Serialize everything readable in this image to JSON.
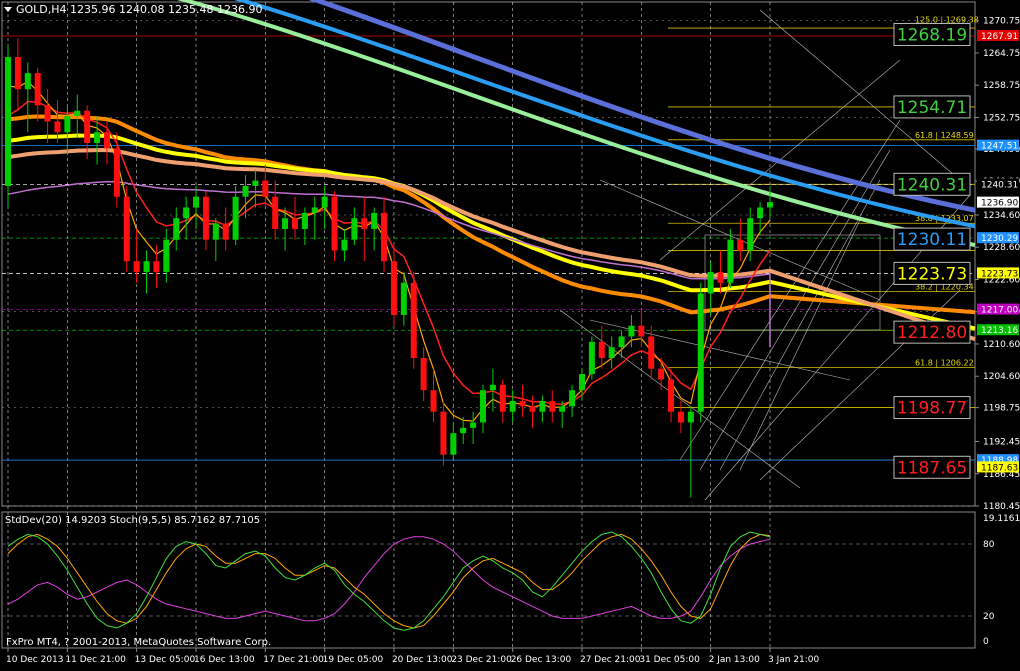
{
  "window": {
    "symbol_line": "GOLD,H4  1235.96 1240.08 1235.48 1236.90",
    "indicator_line": "StdDev(20) 14.9203  Stoch(9,5,5) 85.7162 87.7105",
    "copyright": "FxPro MT4, ? 2001-2013, MetaQuotes Software Corp."
  },
  "colors": {
    "background": "#000000",
    "grid": "#cfcfcf",
    "bull_candle": "#00d000",
    "bear_candle": "#ff1010",
    "ema_fast": "#ffa500",
    "ema_red": "#ff2020",
    "ema_orange": "#ff8c00",
    "ema_yellow": "#ffff00",
    "ema_salmon": "#f0a070",
    "ema_violet": "#c070d0",
    "ema_lightgreen": "#99ee99",
    "ema_blue": "#2a9df4",
    "ema_slateblue": "#5a6fd8"
  },
  "chart_data": {
    "type": "candlestick",
    "symbol": "GOLD",
    "timeframe": "H4",
    "ylim": [
      1180.45,
      1272.0
    ],
    "y_ticks": [
      "1270.75",
      "1264.75",
      "1258.75",
      "1252.75",
      "1246.90",
      "1240.90",
      "1234.60",
      "1228.60",
      "1222.60",
      "1216.60",
      "1210.60",
      "1204.60",
      "1198.75",
      "1192.45",
      "1186.45",
      "1180.45"
    ],
    "x_ticks": [
      "10 Dec 2013",
      "11 Dec 21:00",
      "13 Dec 05:00",
      "16 Dec 13:00",
      "17 Dec 21:00",
      "19 Dec 05:00",
      "20 Dec 13:00",
      "23 Dec 21:00",
      "26 Dec 13:00",
      "27 Dec 21:00",
      "31 Dec 05:00",
      "2 Jan 13:00",
      "3 Jan 21:00"
    ],
    "price_tags": [
      {
        "text": "1267.91",
        "bg": "#e00000",
        "fg": "#ffffff"
      },
      {
        "text": "1247.51",
        "bg": "#1e90ff",
        "fg": "#ffffff"
      },
      {
        "text": "1240.31",
        "bg": "#000000",
        "fg": "#ffffff"
      },
      {
        "text": "1236.90",
        "bg": "#ffffff",
        "fg": "#000000"
      },
      {
        "text": "1230.29",
        "bg": "#1e90ff",
        "fg": "#ffffff"
      },
      {
        "text": "1223.73",
        "bg": "#ffff00",
        "fg": "#000000"
      },
      {
        "text": "1217.00",
        "bg": "#c000c0",
        "fg": "#ffffff"
      },
      {
        "text": "1213.16",
        "bg": "#00c000",
        "fg": "#ffffff"
      },
      {
        "text": "1188.98",
        "bg": "#1e90ff",
        "fg": "#ffffff"
      },
      {
        "text": "1187.63",
        "bg": "#ffff00",
        "fg": "#000000"
      }
    ],
    "levels": [
      {
        "text": "1268.19",
        "value": 1268.19,
        "color": "#40d040"
      },
      {
        "text": "1254.71",
        "value": 1254.71,
        "color": "#40d040"
      },
      {
        "text": "1240.31",
        "value": 1240.31,
        "color": "#40d040"
      },
      {
        "text": "1230.11",
        "value": 1230.11,
        "color": "#2a9df4"
      },
      {
        "text": "1223.73",
        "value": 1223.73,
        "color": "#ffff00"
      },
      {
        "text": "1212.80",
        "value": 1212.8,
        "color": "#ff2020"
      },
      {
        "text": "1198.77",
        "value": 1198.77,
        "color": "#ff2020"
      },
      {
        "text": "1187.65",
        "value": 1187.65,
        "color": "#ff2020"
      }
    ],
    "fib_labels": [
      {
        "text": "125.0 | 1269.38",
        "value": 1270.0
      },
      {
        "text": "61.8 | 1248.59",
        "value": 1248.59
      },
      {
        "text": "38.8 | 1233.07",
        "value": 1233.07
      },
      {
        "text": "38.2 | 1220.34",
        "value": 1220.34
      },
      {
        "text": "61.8 | 1206.22",
        "value": 1206.22
      }
    ],
    "fib_levels": [
      1269.38,
      1254.71,
      1248.59,
      1240.31,
      1233.07,
      1228.0,
      1220.34,
      1213.16,
      1206.22,
      1198.77,
      1188.98
    ],
    "candles": [
      [
        1240.0,
        1266.0,
        1236.0,
        1264.0
      ],
      [
        1264.0,
        1267.5,
        1254.0,
        1258.0
      ],
      [
        1258.0,
        1263.0,
        1250.0,
        1261.0
      ],
      [
        1261.0,
        1262.0,
        1252.0,
        1255.0
      ],
      [
        1255.0,
        1258.0,
        1248.0,
        1252.0
      ],
      [
        1252.0,
        1256.0,
        1248.0,
        1250.0
      ],
      [
        1250.0,
        1255.0,
        1246.0,
        1253.0
      ],
      [
        1253.0,
        1257.0,
        1249.0,
        1254.0
      ],
      [
        1254.0,
        1255.0,
        1245.0,
        1248.0
      ],
      [
        1248.0,
        1253.0,
        1244.0,
        1250.0
      ],
      [
        1250.0,
        1252.0,
        1244.0,
        1247.0
      ],
      [
        1247.0,
        1250.0,
        1236.0,
        1238.0
      ],
      [
        1238.0,
        1240.0,
        1224.0,
        1226.0
      ],
      [
        1226.0,
        1232.0,
        1222.0,
        1224.0
      ],
      [
        1224.0,
        1228.0,
        1220.0,
        1226.0
      ],
      [
        1226.0,
        1229.0,
        1221.0,
        1224.0
      ],
      [
        1224.0,
        1232.0,
        1222.0,
        1230.0
      ],
      [
        1230.0,
        1236.0,
        1228.0,
        1234.0
      ],
      [
        1234.0,
        1238.0,
        1230.0,
        1236.0
      ],
      [
        1236.0,
        1240.0,
        1232.0,
        1238.0
      ],
      [
        1238.0,
        1239.0,
        1228.0,
        1230.0
      ],
      [
        1230.0,
        1234.0,
        1226.0,
        1233.0
      ],
      [
        1233.0,
        1236.0,
        1228.0,
        1230.0
      ],
      [
        1230.0,
        1240.0,
        1229.0,
        1238.0
      ],
      [
        1238.0,
        1242.0,
        1234.0,
        1240.0
      ],
      [
        1240.0,
        1243.0,
        1236.0,
        1241.0
      ],
      [
        1241.0,
        1244.0,
        1236.0,
        1238.0
      ],
      [
        1238.0,
        1241.0,
        1230.0,
        1232.0
      ],
      [
        1232.0,
        1236.0,
        1228.0,
        1234.0
      ],
      [
        1234.0,
        1238.0,
        1230.0,
        1232.0
      ],
      [
        1232.0,
        1236.0,
        1229.0,
        1235.0
      ],
      [
        1235.0,
        1238.0,
        1230.0,
        1236.0
      ],
      [
        1236.0,
        1240.0,
        1232.0,
        1238.0
      ],
      [
        1238.0,
        1239.0,
        1226.0,
        1228.0
      ],
      [
        1228.0,
        1232.0,
        1226.0,
        1230.0
      ],
      [
        1230.0,
        1236.0,
        1229.0,
        1234.0
      ],
      [
        1234.0,
        1238.0,
        1226.0,
        1232.0
      ],
      [
        1232.0,
        1236.0,
        1228.0,
        1235.0
      ],
      [
        1235.0,
        1238.0,
        1224.0,
        1226.0
      ],
      [
        1226.0,
        1229.0,
        1214.0,
        1216.0
      ],
      [
        1216.0,
        1224.0,
        1214.0,
        1222.0
      ],
      [
        1222.0,
        1224.0,
        1206.0,
        1208.0
      ],
      [
        1208.0,
        1210.0,
        1200.0,
        1202.0
      ],
      [
        1202.0,
        1206.0,
        1196.0,
        1198.0
      ],
      [
        1198.0,
        1200.0,
        1188.0,
        1190.0
      ],
      [
        1190.0,
        1196.0,
        1189.0,
        1194.0
      ],
      [
        1194.0,
        1197.0,
        1192.0,
        1195.0
      ],
      [
        1195.0,
        1198.0,
        1192.0,
        1196.0
      ],
      [
        1196.0,
        1203.0,
        1194.0,
        1202.0
      ],
      [
        1202.0,
        1206.0,
        1198.0,
        1203.0
      ],
      [
        1203.0,
        1204.0,
        1196.0,
        1198.0
      ],
      [
        1198.0,
        1202.0,
        1196.0,
        1200.0
      ],
      [
        1200.0,
        1203.0,
        1197.0,
        1199.0
      ],
      [
        1199.0,
        1201.0,
        1195.0,
        1198.0
      ],
      [
        1198.0,
        1201.0,
        1196.0,
        1200.0
      ],
      [
        1200.0,
        1202.0,
        1196.0,
        1198.0
      ],
      [
        1198.0,
        1200.0,
        1195.0,
        1199.0
      ],
      [
        1199.0,
        1203.0,
        1197.0,
        1202.0
      ],
      [
        1202.0,
        1206.0,
        1200.0,
        1205.0
      ],
      [
        1205.0,
        1212.0,
        1204.0,
        1211.0
      ],
      [
        1211.0,
        1214.0,
        1206.0,
        1208.0
      ],
      [
        1208.0,
        1212.0,
        1206.0,
        1210.0
      ],
      [
        1210.0,
        1213.0,
        1208.0,
        1212.0
      ],
      [
        1212.0,
        1216.0,
        1210.0,
        1214.0
      ],
      [
        1214.0,
        1217.0,
        1210.0,
        1212.0
      ],
      [
        1212.0,
        1214.0,
        1204.0,
        1206.0
      ],
      [
        1206.0,
        1208.0,
        1202.0,
        1204.0
      ],
      [
        1204.0,
        1206.0,
        1196.0,
        1198.0
      ],
      [
        1198.0,
        1200.0,
        1194.0,
        1196.0
      ],
      [
        1196.0,
        1199.0,
        1182.0,
        1198.0
      ],
      [
        1198.0,
        1222.0,
        1196.0,
        1220.0
      ],
      [
        1220.0,
        1226.0,
        1216.0,
        1224.0
      ],
      [
        1224.0,
        1228.0,
        1220.0,
        1222.0
      ],
      [
        1222.0,
        1232.0,
        1221.0,
        1230.0
      ],
      [
        1230.0,
        1234.0,
        1226.0,
        1228.0
      ],
      [
        1228.0,
        1236.0,
        1226.0,
        1234.0
      ],
      [
        1234.0,
        1237.0,
        1231.0,
        1236.0
      ],
      [
        1236.0,
        1240.0,
        1234.0,
        1237.0
      ]
    ]
  },
  "indicator": {
    "ylim": [
      0,
      100
    ],
    "y_ticks": [
      "19.1161",
      "80",
      "20",
      "0"
    ],
    "stoch_main_color": "#40e040",
    "stoch_signal_color": "#ffa500",
    "stddev_color": "#e040e0",
    "stoch_main": [
      78,
      84,
      88,
      86,
      80,
      70,
      58,
      44,
      30,
      18,
      12,
      10,
      14,
      22,
      36,
      52,
      68,
      78,
      82,
      80,
      72,
      62,
      60,
      66,
      72,
      74,
      70,
      60,
      52,
      50,
      54,
      60,
      64,
      58,
      46,
      38,
      32,
      24,
      16,
      10,
      8,
      10,
      16,
      26,
      36,
      48,
      60,
      66,
      70,
      66,
      60,
      56,
      50,
      40,
      36,
      44,
      54,
      64,
      74,
      82,
      88,
      90,
      86,
      78,
      68,
      56,
      40,
      26,
      16,
      14,
      20,
      38,
      60,
      78,
      86,
      90,
      88,
      86
    ],
    "stoch_signal": [
      72,
      80,
      86,
      88,
      84,
      78,
      68,
      56,
      44,
      32,
      22,
      16,
      14,
      18,
      28,
      42,
      56,
      68,
      76,
      80,
      78,
      70,
      64,
      64,
      68,
      72,
      72,
      68,
      60,
      54,
      54,
      58,
      62,
      60,
      52,
      44,
      38,
      30,
      22,
      16,
      12,
      10,
      12,
      20,
      30,
      40,
      52,
      60,
      66,
      68,
      64,
      60,
      56,
      48,
      42,
      42,
      48,
      56,
      66,
      74,
      82,
      86,
      88,
      84,
      76,
      66,
      54,
      40,
      28,
      20,
      18,
      26,
      44,
      62,
      76,
      84,
      88,
      87
    ],
    "stddev": [
      30,
      34,
      40,
      46,
      48,
      44,
      38,
      34,
      36,
      40,
      44,
      48,
      50,
      46,
      40,
      34,
      30,
      28,
      26,
      24,
      22,
      20,
      18,
      18,
      20,
      22,
      24,
      22,
      20,
      18,
      16,
      16,
      18,
      22,
      30,
      40,
      52,
      62,
      72,
      80,
      84,
      86,
      86,
      84,
      80,
      74,
      66,
      58,
      50,
      44,
      40,
      36,
      32,
      28,
      24,
      20,
      18,
      18,
      18,
      20,
      22,
      24,
      26,
      28,
      24,
      20,
      18,
      18,
      20,
      24,
      36,
      50,
      62,
      70,
      76,
      80,
      82,
      84
    ]
  }
}
